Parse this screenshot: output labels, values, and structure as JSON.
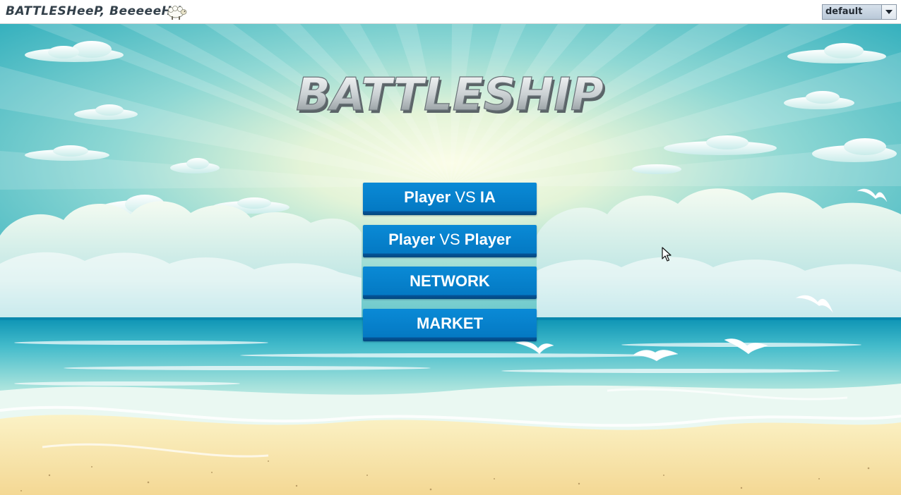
{
  "window": {
    "title": "BATTLESHeeP, BeeeeeH !",
    "theme_select": {
      "value": "default"
    }
  },
  "logo": {
    "text": "BATTLESHIP"
  },
  "menu": {
    "player_vs_ia": {
      "left": "Player",
      "mid": "VS",
      "right": "IA"
    },
    "player_vs_player": {
      "left": "Player",
      "mid": "VS",
      "right": "Player"
    },
    "network": "NETWORK",
    "market": "MARKET"
  },
  "icons": {
    "sheep": "sheep-icon",
    "dropdown": "chevron-down-icon",
    "cursor": "mouse-pointer-icon",
    "gull": "seagull-icon"
  },
  "colors": {
    "button": "#0a84cf",
    "button_shadow": "#03487f",
    "sky_light": "#f2f8d8",
    "sky_dark": "#1aa3b5",
    "sand": "#f6e2a5"
  }
}
